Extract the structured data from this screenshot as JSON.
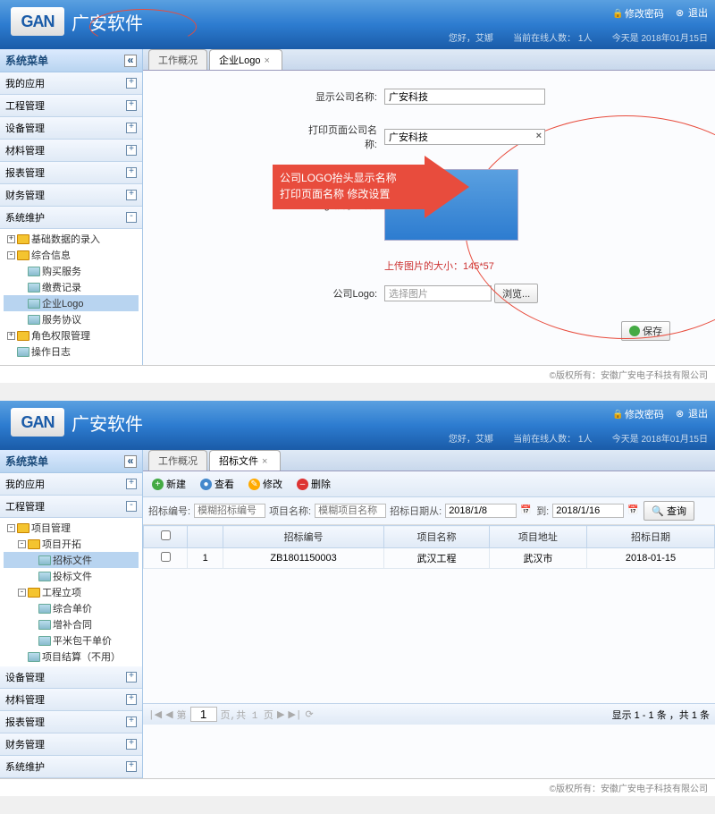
{
  "app": {
    "logo_text": "GAN",
    "brand": "广安软件"
  },
  "header": {
    "change_pwd": "修改密码",
    "logout": "退出",
    "greeting": "您好，艾娜",
    "online_label": "当前在线人数：",
    "online_count": "1人",
    "date_label": "今天是",
    "date_value": "2018年01月15日"
  },
  "sidebar_title": "系统菜单",
  "top1": {
    "menus": [
      {
        "label": "我的应用",
        "exp": "+"
      },
      {
        "label": "工程管理",
        "exp": "+"
      },
      {
        "label": "设备管理",
        "exp": "+"
      },
      {
        "label": "材料管理",
        "exp": "+"
      },
      {
        "label": "报表管理",
        "exp": "+"
      },
      {
        "label": "财务管理",
        "exp": "+"
      },
      {
        "label": "系统维护",
        "exp": "-"
      }
    ],
    "tree": [
      {
        "lvl": 1,
        "pm": "+",
        "ico": "folder",
        "label": "基础数据的录入"
      },
      {
        "lvl": 1,
        "pm": "-",
        "ico": "folder",
        "label": "综合信息"
      },
      {
        "lvl": 2,
        "pm": "",
        "ico": "leaf",
        "label": "购买服务"
      },
      {
        "lvl": 2,
        "pm": "",
        "ico": "leaf",
        "label": "缴费记录"
      },
      {
        "lvl": 2,
        "pm": "",
        "ico": "leaf",
        "label": "企业Logo",
        "sel": true
      },
      {
        "lvl": 2,
        "pm": "",
        "ico": "leaf",
        "label": "服务协议"
      },
      {
        "lvl": 1,
        "pm": "+",
        "ico": "folder",
        "label": "角色权限管理"
      },
      {
        "lvl": 1,
        "pm": "",
        "ico": "leaf",
        "label": "操作日志"
      }
    ],
    "tabs": [
      {
        "label": "工作概况",
        "active": false
      },
      {
        "label": "企业Logo",
        "active": true
      }
    ],
    "form": {
      "company_name_label": "显示公司名称:",
      "company_name": "广安科技",
      "print_name_label": "打印页面公司名称:",
      "print_name": "广安科技",
      "logo_display_label": "Logo展示地方:",
      "upload_hint": "上传图片的大小：145*57",
      "company_logo_label": "公司Logo:",
      "choose_file": "选择图片",
      "browse": "浏览...",
      "save": "保存"
    },
    "callout": {
      "line1": "公司LOGO抬头显示名称",
      "line2": "打印页面名称 修改设置"
    }
  },
  "top2": {
    "menus": [
      {
        "label": "我的应用",
        "exp": "+"
      },
      {
        "label": "工程管理",
        "exp": "-"
      },
      {
        "label": "设备管理",
        "exp": "+"
      },
      {
        "label": "材料管理",
        "exp": "+"
      },
      {
        "label": "报表管理",
        "exp": "+"
      },
      {
        "label": "财务管理",
        "exp": "+"
      },
      {
        "label": "系统维护",
        "exp": "+"
      }
    ],
    "tree": [
      {
        "lvl": 1,
        "pm": "-",
        "ico": "folder",
        "label": "项目管理"
      },
      {
        "lvl": 2,
        "pm": "-",
        "ico": "folder",
        "label": "项目开拓"
      },
      {
        "lvl": 3,
        "pm": "",
        "ico": "leaf",
        "label": "招标文件",
        "sel": true
      },
      {
        "lvl": 3,
        "pm": "",
        "ico": "leaf",
        "label": "投标文件"
      },
      {
        "lvl": 2,
        "pm": "-",
        "ico": "folder",
        "label": "工程立项"
      },
      {
        "lvl": 3,
        "pm": "",
        "ico": "leaf",
        "label": "综合单价"
      },
      {
        "lvl": 3,
        "pm": "",
        "ico": "leaf",
        "label": "增补合同"
      },
      {
        "lvl": 3,
        "pm": "",
        "ico": "leaf",
        "label": "平米包干单价"
      },
      {
        "lvl": 2,
        "pm": "",
        "ico": "leaf",
        "label": "项目结算（不用）"
      }
    ],
    "tabs": [
      {
        "label": "工作概况",
        "active": false
      },
      {
        "label": "招标文件",
        "active": true
      }
    ],
    "toolbar": {
      "new": "新建",
      "view": "查看",
      "edit": "修改",
      "del": "删除"
    },
    "search": {
      "code_label": "招标编号:",
      "code_ph": "模糊招标编号",
      "name_label": "项目名称:",
      "name_ph": "模糊项目名称",
      "date_from_label": "招标日期从:",
      "date_from": "2018/1/8",
      "date_to_label": "到:",
      "date_to": "2018/1/16",
      "query": "查询"
    },
    "grid": {
      "headers": [
        "",
        "",
        "招标编号",
        "项目名称",
        "项目地址",
        "招标日期"
      ],
      "rows": [
        {
          "n": "1",
          "code": "ZB1801150003",
          "name": "武汉工程",
          "addr": "武汉市",
          "date": "2018-01-15"
        }
      ]
    },
    "pager": {
      "page": "1",
      "page_label_pre": "第",
      "page_label_suf": "页,共 1 页",
      "info": "显示 1 - 1 条 ，共 1 条"
    }
  },
  "footer": "©版权所有：安徽广安电子科技有限公司"
}
